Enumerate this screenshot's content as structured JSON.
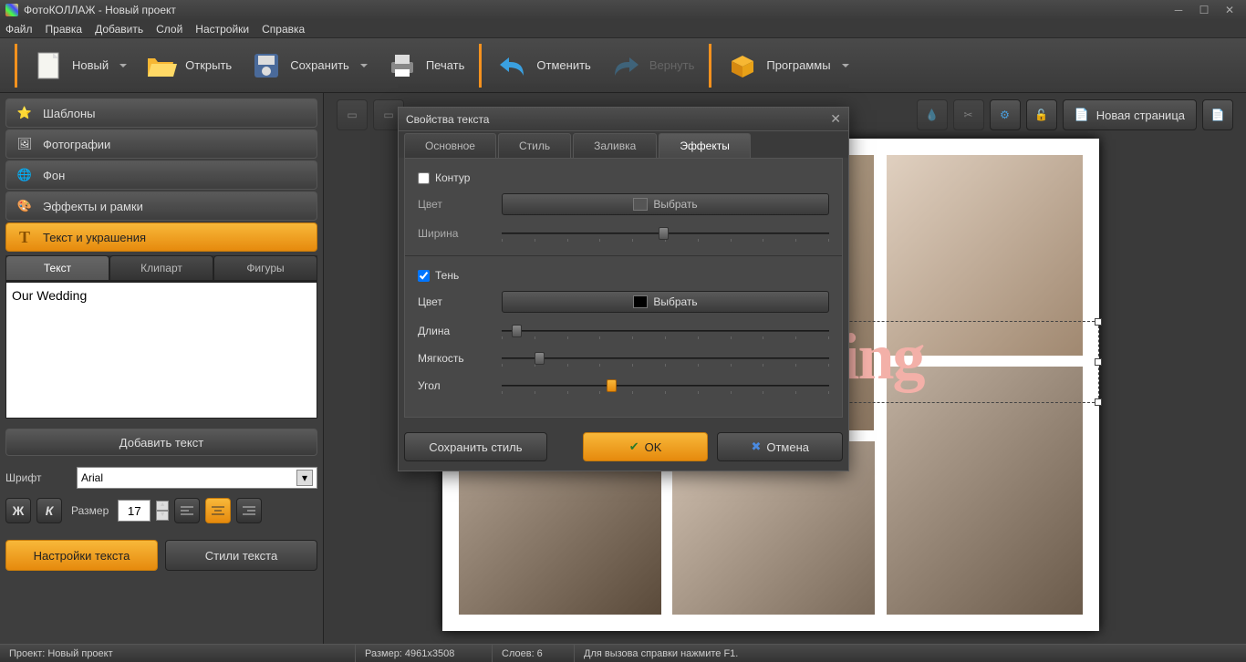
{
  "titlebar": {
    "title": "ФотоКОЛЛАЖ - Новый проект"
  },
  "menus": [
    "Файл",
    "Правка",
    "Добавить",
    "Слой",
    "Настройки",
    "Справка"
  ],
  "toolbar": {
    "new": "Новый",
    "open": "Открыть",
    "save": "Сохранить",
    "print": "Печать",
    "undo": "Отменить",
    "redo": "Вернуть",
    "programs": "Программы"
  },
  "sidebar": {
    "items": [
      "Шаблоны",
      "Фотографии",
      "Фон",
      "Эффекты и рамки",
      "Текст и украшения"
    ],
    "tabs": [
      "Текст",
      "Клипарт",
      "Фигуры"
    ],
    "text_value": "Our Wedding",
    "add_text": "Добавить текст",
    "font_label": "Шрифт",
    "font_value": "Arial",
    "bold": "Ж",
    "italic": "К",
    "size_label": "Размер",
    "size_value": "17",
    "text_settings": "Настройки текста",
    "text_styles": "Стили текста"
  },
  "canvas": {
    "new_page": "Новая страница",
    "overlay_text": "Our Wedding"
  },
  "dialog": {
    "title": "Свойства текста",
    "tabs": [
      "Основное",
      "Стиль",
      "Заливка",
      "Эффекты"
    ],
    "contour": {
      "label": "Контур",
      "color_label": "Цвет",
      "choose": "Выбрать",
      "width_label": "Ширина"
    },
    "shadow": {
      "label": "Тень",
      "color_label": "Цвет",
      "choose": "Выбрать",
      "length_label": "Длина",
      "softness_label": "Мягкость",
      "angle_label": "Угол"
    },
    "save_style": "Сохранить стиль",
    "ok": "OK",
    "cancel": "Отмена"
  },
  "statusbar": {
    "project": "Проект:  Новый проект",
    "size": "Размер:  4961x3508",
    "layers": "Слоев:  6",
    "help": "Для вызова справки нажмите F1."
  }
}
